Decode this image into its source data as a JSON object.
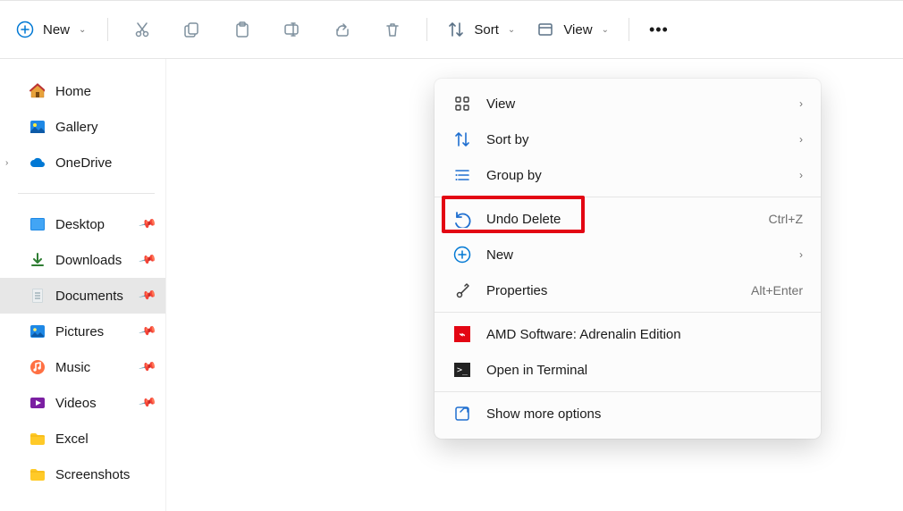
{
  "toolbar": {
    "new_label": "New",
    "sort_label": "Sort",
    "view_label": "View"
  },
  "sidebar": {
    "top": [
      {
        "label": "Home",
        "icon": "home"
      },
      {
        "label": "Gallery",
        "icon": "gallery"
      },
      {
        "label": "OneDrive",
        "icon": "onedrive",
        "expandable": true
      }
    ],
    "pinned": [
      {
        "label": "Desktop",
        "icon": "desktop",
        "pinned": true
      },
      {
        "label": "Downloads",
        "icon": "downloads",
        "pinned": true
      },
      {
        "label": "Documents",
        "icon": "documents",
        "pinned": true,
        "selected": true
      },
      {
        "label": "Pictures",
        "icon": "pictures",
        "pinned": true
      },
      {
        "label": "Music",
        "icon": "music",
        "pinned": true
      },
      {
        "label": "Videos",
        "icon": "videos",
        "pinned": true
      },
      {
        "label": "Excel",
        "icon": "folder"
      },
      {
        "label": "Screenshots",
        "icon": "folder"
      }
    ]
  },
  "context_menu": {
    "items": [
      {
        "label": "View",
        "icon": "view-grid",
        "has_submenu": true
      },
      {
        "label": "Sort by",
        "icon": "sort",
        "has_submenu": true
      },
      {
        "label": "Group by",
        "icon": "group",
        "has_submenu": true
      },
      {
        "divider": true
      },
      {
        "label": "Undo Delete",
        "icon": "undo",
        "shortcut": "Ctrl+Z",
        "highlighted": true
      },
      {
        "label": "New",
        "icon": "new-plus",
        "has_submenu": true
      },
      {
        "label": "Properties",
        "icon": "properties",
        "shortcut": "Alt+Enter"
      },
      {
        "divider": true
      },
      {
        "label": "AMD Software: Adrenalin Edition",
        "icon": "amd"
      },
      {
        "label": "Open in Terminal",
        "icon": "terminal"
      },
      {
        "divider": true
      },
      {
        "label": "Show more options",
        "icon": "show-more"
      }
    ]
  }
}
